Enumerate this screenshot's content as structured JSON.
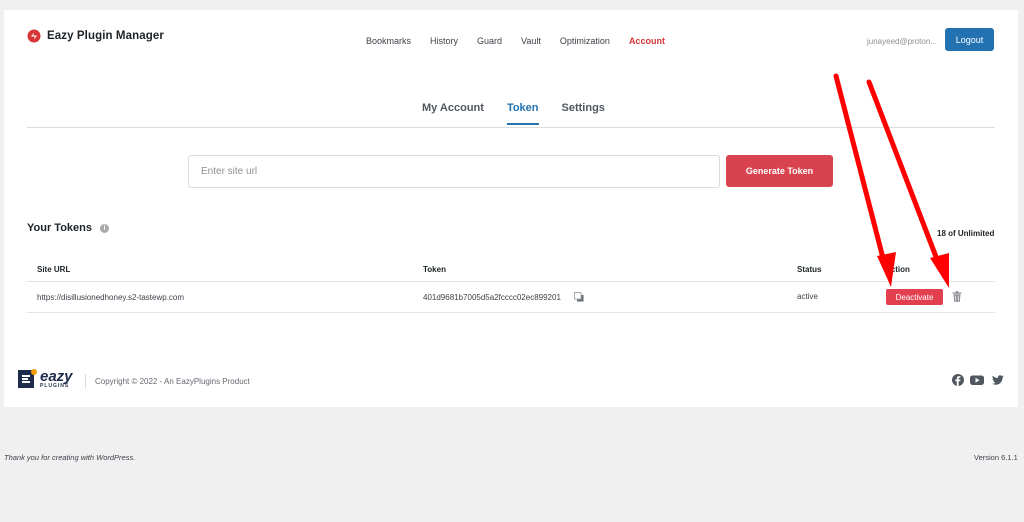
{
  "header": {
    "brand": "Eazy Plugin Manager",
    "nav": [
      "Bookmarks",
      "History",
      "Guard",
      "Vault",
      "Optimization",
      "Account"
    ],
    "active_nav": "Account",
    "user_email": "junayeed@proton...",
    "logout_label": "Logout"
  },
  "tabs": {
    "items": [
      "My Account",
      "Token",
      "Settings"
    ],
    "active": "Token"
  },
  "token_form": {
    "placeholder": "Enter site url",
    "generate_label": "Generate Token"
  },
  "tokens": {
    "title": "Your Tokens",
    "count": "18 of Unlimited",
    "columns": [
      "Site URL",
      "Token",
      "Status",
      "Action"
    ],
    "rows": [
      {
        "site_url": "https://disillusionedhoney.s2-tastewp.com",
        "token": "401d9681b7005d5a2fcccc02ec899201",
        "status": "active",
        "action_label": "Deactivate"
      }
    ]
  },
  "footer": {
    "logo_text": "eazy",
    "logo_subtext": "PLUGINS",
    "copyright": "Copyright © 2022 - An EazyPlugins Product",
    "social_icons": [
      "facebook-icon",
      "youtube-icon",
      "twitter-icon"
    ]
  },
  "wp_footer": {
    "thanks": "Thank you for creating with WordPress.",
    "version": "Version 6.1.1"
  },
  "colors": {
    "accent_blue": "#2271b1",
    "accent_red": "#d9434f",
    "annotation_arrow": "#ff0000"
  }
}
